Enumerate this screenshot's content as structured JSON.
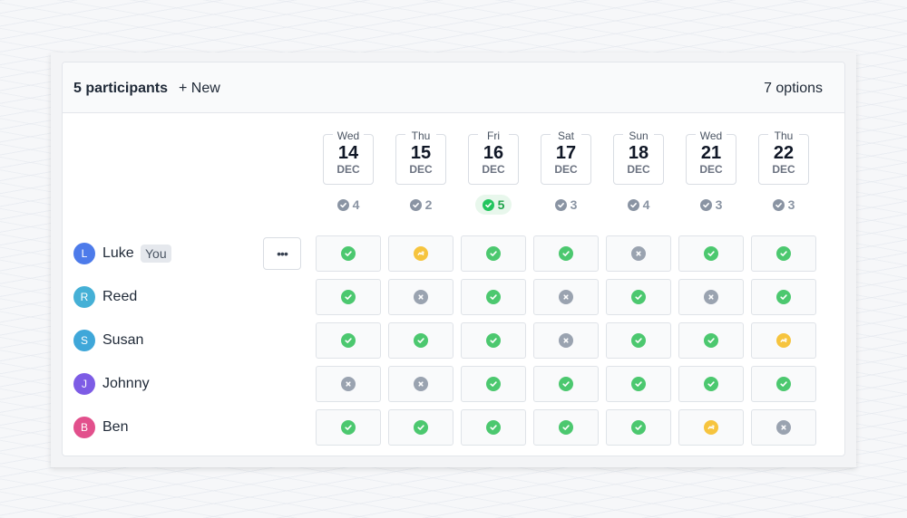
{
  "header": {
    "participants_label": "5 participants",
    "new_label": "+ New",
    "options_label": "7 options"
  },
  "options": [
    {
      "dow": "Wed",
      "day": "14",
      "month": "DEC",
      "score": "4",
      "best": false
    },
    {
      "dow": "Thu",
      "day": "15",
      "month": "DEC",
      "score": "2",
      "best": false
    },
    {
      "dow": "Fri",
      "day": "16",
      "month": "DEC",
      "score": "5",
      "best": true
    },
    {
      "dow": "Sat",
      "day": "17",
      "month": "DEC",
      "score": "3",
      "best": false
    },
    {
      "dow": "Sun",
      "day": "18",
      "month": "DEC",
      "score": "4",
      "best": false
    },
    {
      "dow": "Wed",
      "day": "21",
      "month": "DEC",
      "score": "3",
      "best": false
    },
    {
      "dow": "Thu",
      "day": "22",
      "month": "DEC",
      "score": "3",
      "best": false
    }
  ],
  "you_label": "You",
  "more_label": "•••",
  "participants": [
    {
      "initial": "L",
      "name": "Luke",
      "color": "#4d7bea",
      "you": true,
      "votes": [
        "yes",
        "maybe",
        "yes",
        "yes",
        "no",
        "yes",
        "yes"
      ]
    },
    {
      "initial": "R",
      "name": "Reed",
      "color": "#45b0d6",
      "you": false,
      "votes": [
        "yes",
        "no",
        "yes",
        "no",
        "yes",
        "no",
        "yes"
      ]
    },
    {
      "initial": "S",
      "name": "Susan",
      "color": "#3fa7d9",
      "you": false,
      "votes": [
        "yes",
        "yes",
        "yes",
        "no",
        "yes",
        "yes",
        "maybe"
      ]
    },
    {
      "initial": "J",
      "name": "Johnny",
      "color": "#7d5ce5",
      "you": false,
      "votes": [
        "no",
        "no",
        "yes",
        "yes",
        "yes",
        "yes",
        "yes"
      ]
    },
    {
      "initial": "B",
      "name": "Ben",
      "color": "#e2508c",
      "you": false,
      "votes": [
        "yes",
        "yes",
        "yes",
        "yes",
        "yes",
        "maybe",
        "no"
      ]
    }
  ],
  "colors": {
    "yes": "#4cc86f",
    "no": "#9aa3b0",
    "maybe": "#f6c43e",
    "best": "#22a54c"
  }
}
